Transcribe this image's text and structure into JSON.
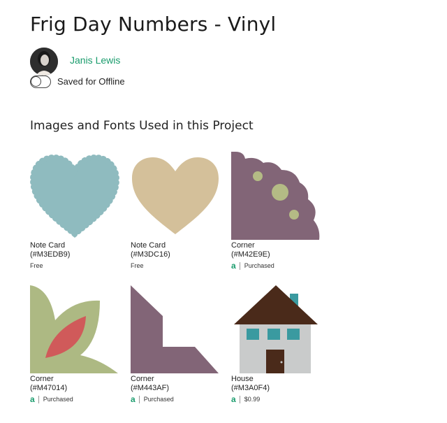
{
  "project": {
    "title": "Frig Day Numbers - Vinyl"
  },
  "author": {
    "name": "Janis Lewis"
  },
  "offline": {
    "label": "Saved for Offline"
  },
  "section": {
    "title": "Images and Fonts Used in this Project"
  },
  "items": [
    {
      "name": "Note Card",
      "code": "(#M3EDB9)",
      "price": "Free",
      "access": false,
      "image": "scalloped-heart",
      "color": "#8fbbbf"
    },
    {
      "name": "Note Card",
      "code": "(#M3DC16)",
      "price": "Free",
      "access": false,
      "image": "heart",
      "color": "#d4c09a"
    },
    {
      "name": "Corner",
      "code": "(#M42E9E)",
      "price": "Purchased",
      "access": true,
      "image": "scalloped-corner",
      "color": "#826577"
    },
    {
      "name": "Corner",
      "code": "(#M47014)",
      "price": "Purchased",
      "access": true,
      "image": "leaf-corner",
      "color": "#adb983"
    },
    {
      "name": "Corner",
      "code": "(#M443AF)",
      "price": "Purchased",
      "access": true,
      "image": "angle-corner",
      "color": "#826577"
    },
    {
      "name": "House",
      "code": "(#M3A0F4)",
      "price": "$0.99",
      "access": true,
      "image": "house",
      "color": "#4a2a1a"
    }
  ],
  "access_icon": "access-a-icon"
}
